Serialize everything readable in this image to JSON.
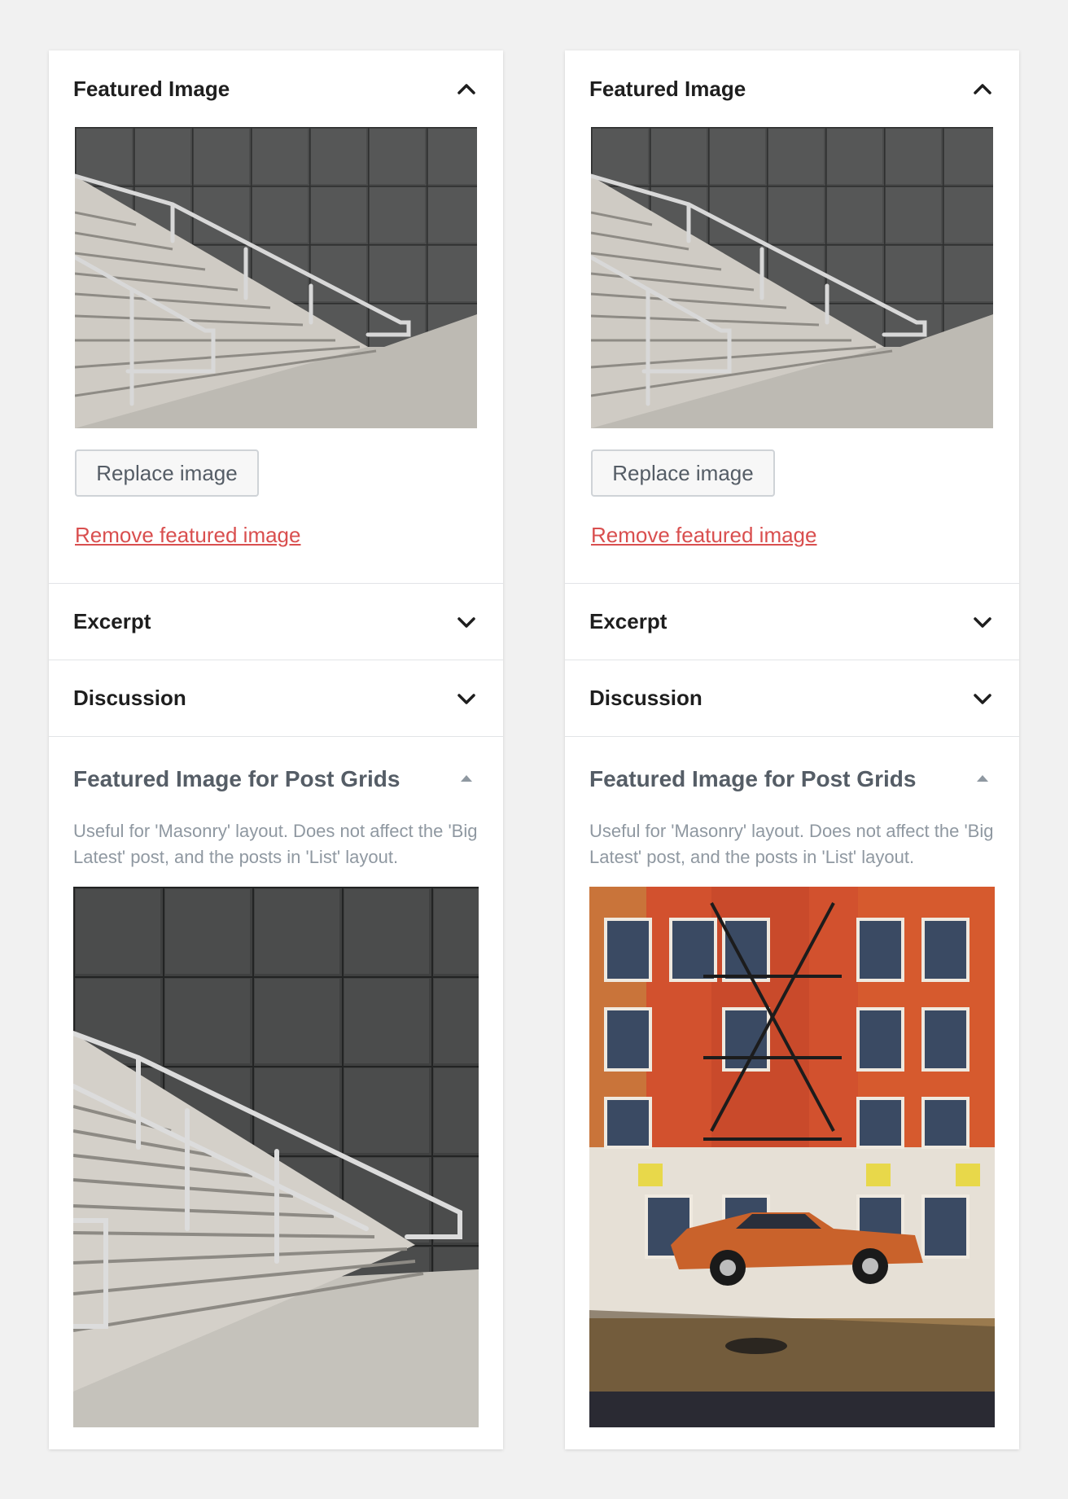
{
  "panels": [
    {
      "featured_image": {
        "title": "Featured Image",
        "toggle_icon": "chevron-up-icon",
        "image": "stairs-photo",
        "replace_label": "Replace image",
        "remove_label": "Remove featured image"
      },
      "excerpt": {
        "title": "Excerpt",
        "toggle_icon": "chevron-down-icon"
      },
      "discussion": {
        "title": "Discussion",
        "toggle_icon": "chevron-down-icon"
      },
      "post_grids": {
        "title": "Featured Image for Post Grids",
        "toggle_icon": "caret-up-icon",
        "description": "Useful for 'Masonry' layout. Does not affect the 'Big Latest' post, and the posts in 'List' layout.",
        "image": "stairs-photo-tall"
      }
    },
    {
      "featured_image": {
        "title": "Featured Image",
        "toggle_icon": "chevron-up-icon",
        "image": "stairs-photo",
        "replace_label": "Replace image",
        "remove_label": "Remove featured image"
      },
      "excerpt": {
        "title": "Excerpt",
        "toggle_icon": "chevron-down-icon"
      },
      "discussion": {
        "title": "Discussion",
        "toggle_icon": "chevron-down-icon"
      },
      "post_grids": {
        "title": "Featured Image for Post Grids",
        "toggle_icon": "caret-up-icon",
        "description": "Useful for 'Masonry' layout. Does not affect the 'Big Latest' post, and the posts in 'List' layout.",
        "image": "street-car-photo"
      }
    }
  ],
  "colors": {
    "background": "#f1f1f1",
    "panel": "#ffffff",
    "remove_link": "#d94f4f",
    "muted_text": "#8f98a1",
    "heading": "#1e1e1e"
  }
}
